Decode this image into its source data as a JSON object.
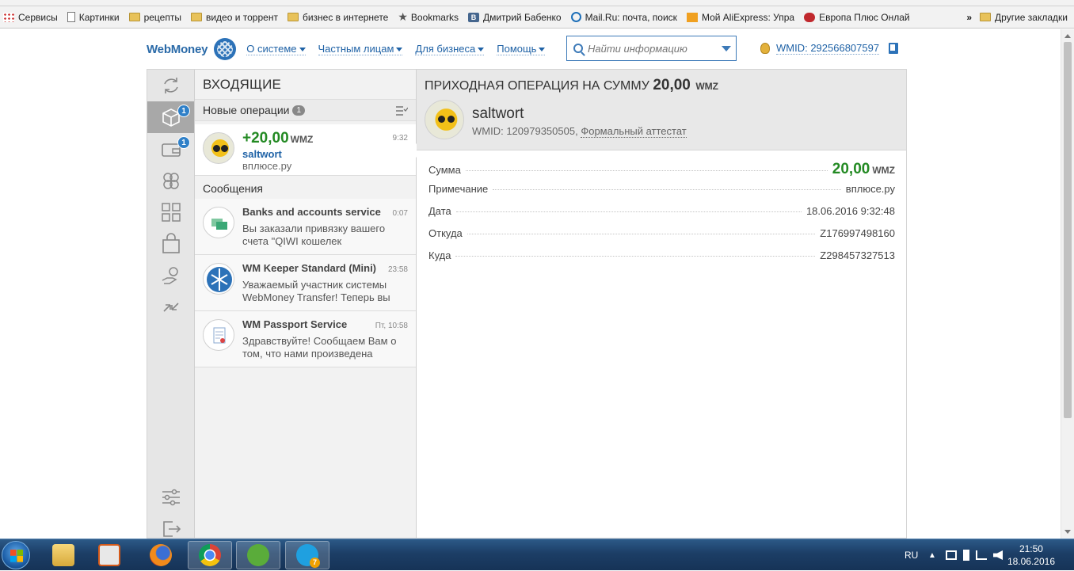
{
  "bookmarks": {
    "items": [
      {
        "label": "Сервисы",
        "icon": "apps-grid-icon"
      },
      {
        "label": "Картинки",
        "icon": "page-icon"
      },
      {
        "label": "рецепты",
        "icon": "folder-icon"
      },
      {
        "label": "видео и торрент",
        "icon": "folder-icon"
      },
      {
        "label": "бизнес в интернете",
        "icon": "folder-icon"
      },
      {
        "label": "Bookmarks",
        "icon": "star-icon"
      },
      {
        "label": "Дмитрий Бабенко",
        "icon": "vk-icon"
      },
      {
        "label": "Mail.Ru: почта, поиск",
        "icon": "mail-ru-icon"
      },
      {
        "label": "Мой AliExpress: Упра",
        "icon": "aliexpress-icon"
      },
      {
        "label": "Европа Плюс Онлай",
        "icon": "europa-plus-icon"
      }
    ],
    "more": "»",
    "other": "Другие закладки"
  },
  "header": {
    "logo": "WebMoney",
    "nav": [
      "О системе",
      "Частным лицам",
      "Для бизнеса",
      "Помощь"
    ],
    "search_placeholder": "Найти информацию",
    "wmid": "WMID: 292566807597"
  },
  "sidebar": {
    "icons": [
      "refresh-icon",
      "inbox-box-icon",
      "wallet-icon",
      "contacts-icon",
      "apps-icon",
      "shopping-bag-icon",
      "hand-coin-icon",
      "exchange-arrows-icon",
      "settings-sliders-icon",
      "logout-icon"
    ],
    "badges": {
      "inbox": "1",
      "wallet": "1"
    }
  },
  "inbox": {
    "title": "ВХОДЯЩИЕ",
    "new_ops_label": "Новые операции",
    "new_ops_count": "1",
    "operation": {
      "amount": "+20,00",
      "currency": "WMZ",
      "time": "9:32",
      "name": "saltwort",
      "note": "вплюсе.ру"
    },
    "messages_label": "Сообщения",
    "messages": [
      {
        "title": "Banks and accounts service",
        "time": "0:07",
        "body": "Вы заказали привязку вашего счета \"QIWI кошелек"
      },
      {
        "title": "WM Keeper Standard (Mini)",
        "time": "23:58",
        "body": "Уважаемый участник системы WebMoney Transfer! Теперь вы"
      },
      {
        "title": "WM Passport Service",
        "time": "Пт, 10:58",
        "body": "Здравствуйте! Сообщаем Вам о том, что нами произведена"
      }
    ]
  },
  "detail": {
    "title_prefix": "ПРИХОДНАЯ ОПЕРАЦИЯ НА СУММУ",
    "title_amount": "20,00",
    "title_currency": "WMZ",
    "party_name": "saltwort",
    "party_wmid": "WMID: 120979350505,",
    "party_attestat": "Формальный аттестат",
    "rows": [
      {
        "label": "Сумма",
        "value": "20,00",
        "currency": "WMZ"
      },
      {
        "label": "Примечание",
        "value": "вплюсе.ру"
      },
      {
        "label": "Дата",
        "value": "18.06.2016 9:32:48"
      },
      {
        "label": "Откуда",
        "value": "Z176997498160"
      },
      {
        "label": "Куда",
        "value": "Z298457327513"
      }
    ]
  },
  "taskbar": {
    "apps": [
      "explorer-icon",
      "media-player-icon",
      "firefox-icon",
      "chrome-icon",
      "utorrent-icon",
      "skype-icon"
    ],
    "skype_badge": "7",
    "lang": "RU",
    "time": "21:50",
    "date": "18.06.2016"
  }
}
